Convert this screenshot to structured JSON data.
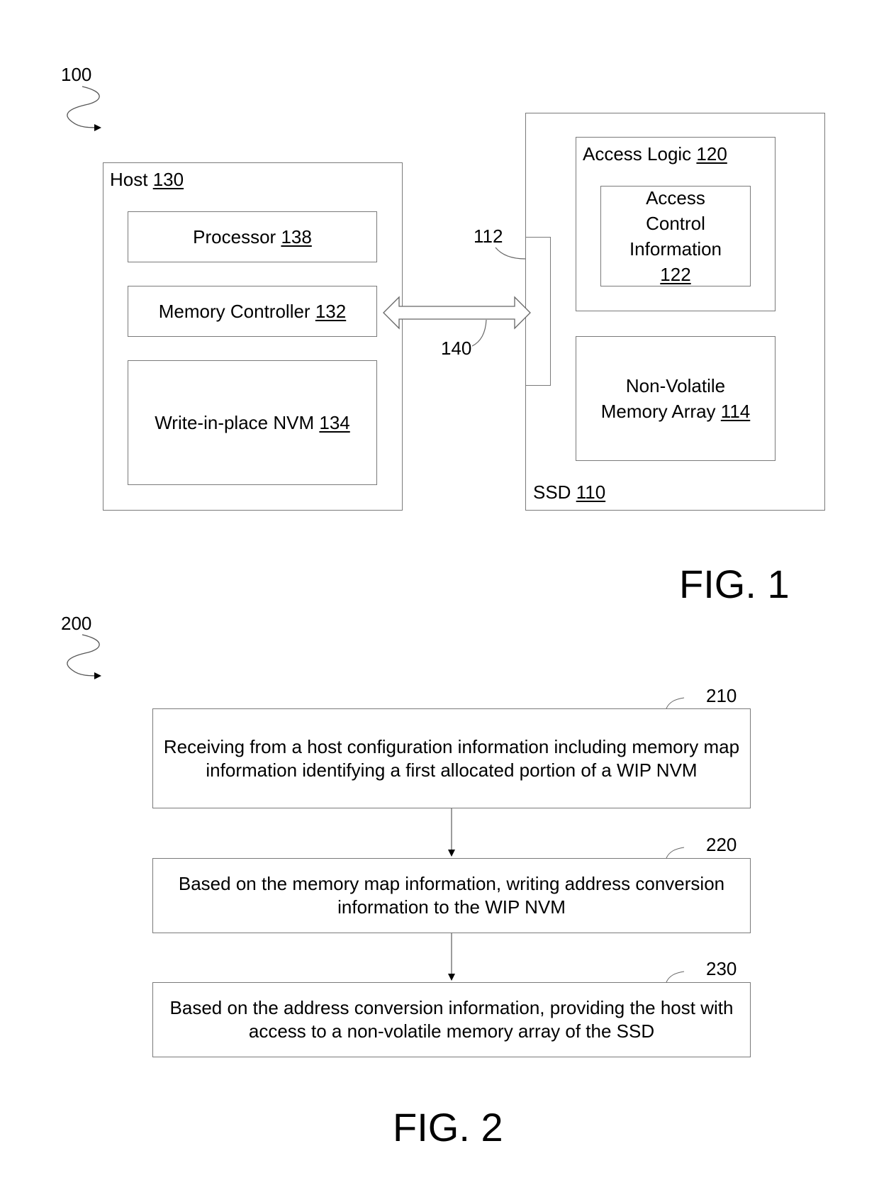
{
  "fig1": {
    "ref_number": "100",
    "caption": "FIG. 1",
    "host": {
      "name": "Host",
      "ref": "130"
    },
    "processor": {
      "name": "Processor",
      "ref": "138"
    },
    "memory_controller": {
      "name": "Memory Controller",
      "ref": "132"
    },
    "wip_nvm": {
      "name": "Write-in-place NVM",
      "ref": "134"
    },
    "interface_ref": "112",
    "link_ref": "140",
    "ssd": {
      "name": "SSD",
      "ref": "110"
    },
    "access_logic": {
      "name": "Access Logic",
      "ref": "120"
    },
    "access_control_info": {
      "lines": [
        "Access",
        "Control",
        "Information"
      ],
      "ref": "122"
    },
    "nvm_array": {
      "line1": "Non-Volatile",
      "line2": "Memory Array",
      "ref": "114"
    }
  },
  "fig2": {
    "ref_number": "200",
    "caption": "FIG. 2",
    "steps": [
      {
        "ref": "210",
        "text": "Receiving from a host configuration information including memory map information identifying a first allocated portion of a WIP NVM"
      },
      {
        "ref": "220",
        "text": "Based on the memory map information, writing address conversion information to the WIP NVM"
      },
      {
        "ref": "230",
        "text": "Based on the address conversion information, providing the host with access to a non-volatile memory array of the SSD"
      }
    ]
  }
}
